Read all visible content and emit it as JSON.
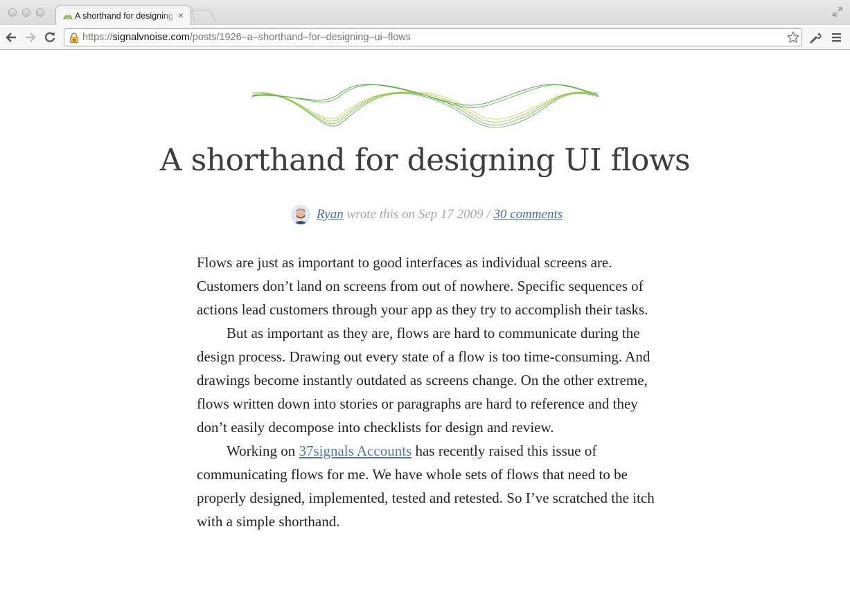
{
  "browser": {
    "tab_title": "A shorthand for designing UI flows",
    "tab_close": "×",
    "url_scheme": "https://",
    "url_domain": "signalvnoise.com",
    "url_path": "/posts/1926–a–shorthand–for–designing–ui–flows",
    "icons": [
      "back-arrow-icon",
      "forward-arrow-icon",
      "reload-icon",
      "lock-icon",
      "star-icon",
      "wrench-icon",
      "menu-icon",
      "fullscreen-icon"
    ]
  },
  "post": {
    "title": "A shorthand for designing UI flows",
    "author": "Ryan",
    "byline_middle": " wrote this on Sep 17 2009 / ",
    "comments_link": "30 comments",
    "paragraphs": [
      {
        "text": "Flows are just as important to good interfaces as individual screens are. Customers don’t land on screens from out of nowhere. Specific sequences of actions lead customers through your app as they try to accomplish their tasks."
      },
      {
        "text": "But as important as they are, flows are hard to communicate during the design process. Drawing out every state of a flow is too time-consuming. And drawings become instantly outdated as screens change. On the other extreme, flows written down into stories or paragraphs are hard to reference and they don’t easily decompose into checklists for design and review."
      },
      {
        "before_link": "Working on ",
        "link": "37signals Accounts",
        "after_link": " has recently raised this issue of communicating flows for me. We have whole sets of flows that need to be properly designed, implemented, tested and retested. So I’ve scratched the itch with a simple shorthand."
      }
    ]
  },
  "colors": {
    "link": "#4a7898",
    "wave_green": "#5fb04a",
    "wave_yellow": "#c9d64a"
  }
}
